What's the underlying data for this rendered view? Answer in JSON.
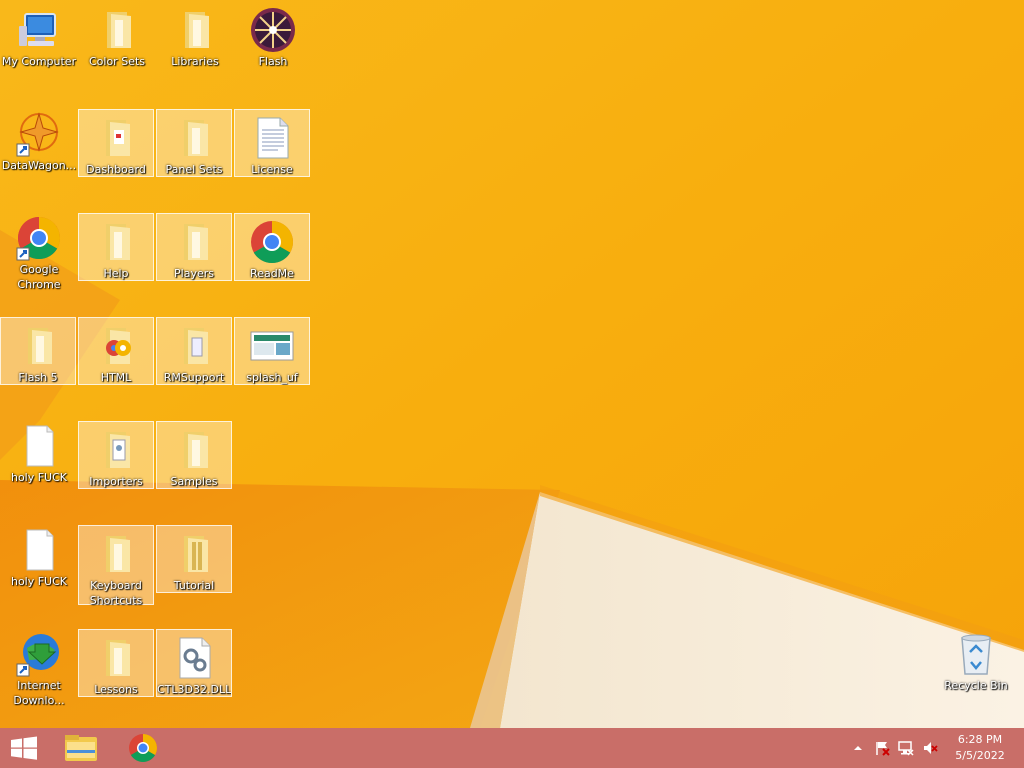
{
  "desktop": {
    "icons": [
      {
        "label": "My Computer"
      },
      {
        "label": "Color Sets"
      },
      {
        "label": "Libraries"
      },
      {
        "label": "Flash"
      },
      {
        "label": "DataWagon..."
      },
      {
        "label": "Dashboard"
      },
      {
        "label": "Panel Sets"
      },
      {
        "label": "License"
      },
      {
        "label": "Google\nChrome"
      },
      {
        "label": "Help"
      },
      {
        "label": "Players"
      },
      {
        "label": "ReadMe"
      },
      {
        "label": "Flash 5"
      },
      {
        "label": "HTML"
      },
      {
        "label": "RMSupport"
      },
      {
        "label": "splash_uf"
      },
      {
        "label": "holy FUCK"
      },
      {
        "label": "Importers"
      },
      {
        "label": "Samples"
      },
      {
        "label": "holy FUCK"
      },
      {
        "label": "Keyboard\nShortcuts"
      },
      {
        "label": "Tutorial"
      },
      {
        "label": "Internet\nDownlo..."
      },
      {
        "label": "Lessons"
      },
      {
        "label": "CTL3D32.DLL"
      },
      {
        "label": "Recycle Bin"
      }
    ]
  },
  "taskbar": {
    "start": "start-icon",
    "pinned": [
      "file-explorer-icon",
      "chrome-icon"
    ],
    "tray": [
      "show-hidden-icons-icon",
      "action-center-flag-icon",
      "network-icon",
      "volume-muted-icon"
    ],
    "time": "6:28 PM",
    "date": "5/5/2022"
  },
  "colors": {
    "wallpaper": "#f7ad10",
    "taskbar": "#c96e68",
    "folder": "#f3d57a"
  }
}
